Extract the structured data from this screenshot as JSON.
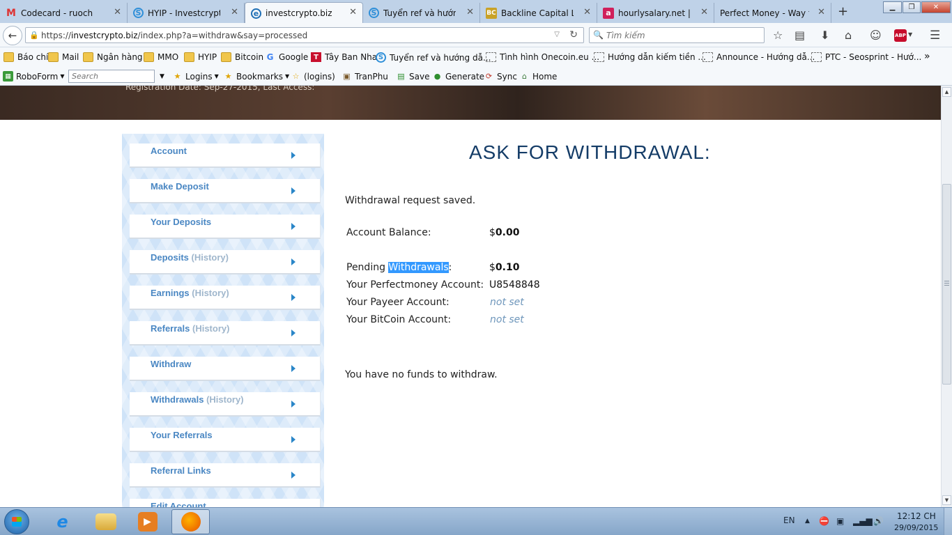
{
  "browser": {
    "tabs": [
      {
        "title": "Codecard - ruochu...",
        "icon": "gmail-icon",
        "active": false
      },
      {
        "title": "HYIP - Investcrypt...",
        "icon": "s-circle-icon",
        "active": false
      },
      {
        "title": "investcrypto.biz",
        "icon": "investcrypto-icon",
        "active": true
      },
      {
        "title": "Tuyển ref và hướn...",
        "icon": "s-circle-icon",
        "active": false
      },
      {
        "title": "Backline Capital Li...",
        "icon": "bc-icon",
        "active": false
      },
      {
        "title": "hourlysalary.net | ...",
        "icon": "a-icon",
        "active": false
      },
      {
        "title": "Perfect Money - Way t...",
        "icon": "",
        "active": false
      }
    ],
    "url_prefix": "https://",
    "url_host": "investcrypto.biz",
    "url_path": "/index.php?a=withdraw&say=processed",
    "search_placeholder": "Tìm kiếm",
    "abp_label": "ABP",
    "bookmarks": [
      {
        "label": "Báo chí",
        "icon": "folder-icon"
      },
      {
        "label": "Mail",
        "icon": "folder-icon"
      },
      {
        "label": "Ngân hàng",
        "icon": "folder-icon"
      },
      {
        "label": "MMO",
        "icon": "folder-icon"
      },
      {
        "label": "HYIP",
        "icon": "folder-icon"
      },
      {
        "label": "Bitcoin",
        "icon": "folder-icon"
      },
      {
        "label": "Google",
        "icon": "google-icon"
      },
      {
        "label": "Tây Ban Nha",
        "icon": "t-icon"
      },
      {
        "label": "Tuyển ref và hướng dẫ...",
        "icon": "s-circle-icon"
      },
      {
        "label": "Tình hình Onecoin.eu ...",
        "icon": "blank-page-icon"
      },
      {
        "label": "Hướng dẫn kiếm tiền ...",
        "icon": "blank-page-icon"
      },
      {
        "label": "Announce - Hướng dẫ...",
        "icon": "blank-page-icon"
      },
      {
        "label": "PTC - Seosprint - Hướ...",
        "icon": "blank-page-icon"
      }
    ],
    "roboform": {
      "brand": "RoboForm",
      "search_placeholder": "Search",
      "logins": "Logins",
      "bookmarks": "Bookmarks",
      "logins_paren": "(logins)",
      "tranphu": "TranPhu",
      "save": "Save",
      "generate": "Generate",
      "sync": "Sync",
      "home": "Home"
    }
  },
  "page": {
    "hero_text": "Registration Date: Sep-27-2015, Last Access:",
    "heading": "ASK FOR WITHDRAWAL:",
    "saved_msg": "Withdrawal request saved.",
    "balance_label": "Account Balance:",
    "balance_currency": "$",
    "balance_value": "0.00",
    "pending_label_pre": "Pending ",
    "pending_label_sel": "Withdrawals",
    "pending_label_post": ":",
    "pending_currency": "$",
    "pending_value": "0.10",
    "pm_label": "Your Perfectmoney Account:",
    "pm_value": "U8548848",
    "payeer_label": "Your Payeer Account:",
    "payeer_value": "not set",
    "btc_label": "Your BitCoin Account:",
    "btc_value": "not set",
    "no_funds_msg": "You have no funds to withdraw."
  },
  "sidebar": {
    "items": [
      {
        "label": "Account",
        "hist": ""
      },
      {
        "label": "Make Deposit",
        "hist": ""
      },
      {
        "label": "Your Deposits",
        "hist": ""
      },
      {
        "label": "Deposits",
        "hist": "(History)"
      },
      {
        "label": "Earnings",
        "hist": "(History)"
      },
      {
        "label": "Referrals",
        "hist": "(History)"
      },
      {
        "label": "Withdraw",
        "hist": ""
      },
      {
        "label": "Withdrawals",
        "hist": "(History)"
      },
      {
        "label": "Your Referrals",
        "hist": ""
      },
      {
        "label": "Referral Links",
        "hist": ""
      },
      {
        "label": "Edit Account",
        "hist": ""
      }
    ]
  },
  "taskbar": {
    "lang": "EN",
    "time": "12:12 CH",
    "date": "29/09/2015"
  },
  "colors": {
    "heading": "#143c67",
    "menu_link": "#4a87c3",
    "menu_history": "#9fb6cc",
    "not_set": "#6e96bb",
    "selection": "#3399ff",
    "menu_arrow": "#2a86c8"
  }
}
